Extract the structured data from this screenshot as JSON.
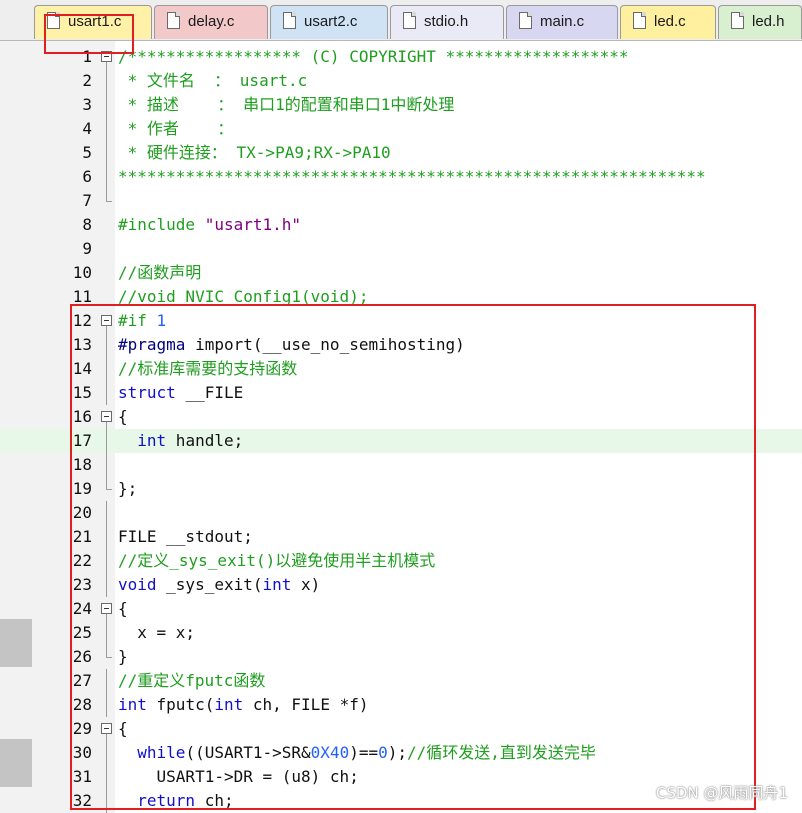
{
  "tabs": [
    {
      "label": "usart1.c",
      "active": true,
      "color": "#fff2a8",
      "icon": "c-file-icon"
    },
    {
      "label": "delay.c",
      "active": false,
      "color": "#f2c8c8",
      "icon": "c-file-icon"
    },
    {
      "label": "usart2.c",
      "active": false,
      "color": "#cfe3f5",
      "icon": "c-file-icon"
    },
    {
      "label": "stdio.h",
      "active": false,
      "color": "#eaeaf6",
      "icon": "h-file-icon"
    },
    {
      "label": "main.c",
      "active": false,
      "color": "#d7d7f2",
      "icon": "c-file-icon"
    },
    {
      "label": "led.c",
      "active": false,
      "color": "#fff0a0",
      "icon": "c-file-icon"
    },
    {
      "label": "led.h",
      "active": false,
      "color": "#d8efd0",
      "icon": "h-file-icon"
    }
  ],
  "editor": {
    "lines": [
      {
        "n": "1",
        "fold": "open",
        "tokens": [
          [
            "cm",
            "/****************** (C) COPYRIGHT *******************"
          ]
        ]
      },
      {
        "n": "2",
        "fold": "line",
        "tokens": [
          [
            "cm",
            " * 文件名  ： usart.c"
          ]
        ]
      },
      {
        "n": "3",
        "fold": "line",
        "tokens": [
          [
            "cm",
            " * 描述    ： 串口1的配置和串口1中断处理"
          ]
        ]
      },
      {
        "n": "4",
        "fold": "line",
        "tokens": [
          [
            "cm",
            " * 作者    ："
          ]
        ]
      },
      {
        "n": "5",
        "fold": "line",
        "tokens": [
          [
            "cm",
            " * 硬件连接： TX->PA9;RX->PA10"
          ]
        ]
      },
      {
        "n": "6",
        "fold": "line",
        "tokens": [
          [
            "cm",
            "*************************************************************"
          ]
        ]
      },
      {
        "n": "7",
        "fold": "end",
        "tokens": []
      },
      {
        "n": "8",
        "fold": "",
        "tokens": [
          [
            "pp",
            "#include "
          ],
          [
            "str",
            "\"usart1.h\""
          ]
        ]
      },
      {
        "n": "9",
        "fold": "",
        "tokens": []
      },
      {
        "n": "10",
        "fold": "",
        "tokens": [
          [
            "cm",
            "//函数声明"
          ]
        ]
      },
      {
        "n": "11",
        "fold": "",
        "tokens": [
          [
            "cm",
            "//void NVIC_Config1(void);"
          ]
        ]
      },
      {
        "n": "12",
        "fold": "open",
        "tokens": [
          [
            "pp",
            "#if "
          ],
          [
            "num",
            "1"
          ]
        ]
      },
      {
        "n": "13",
        "fold": "line",
        "tokens": [
          [
            "ppw",
            "#pragma"
          ],
          [
            "id",
            " import(__use_no_semihosting)"
          ]
        ]
      },
      {
        "n": "14",
        "fold": "line",
        "tokens": [
          [
            "cm",
            "//标准库需要的支持函数"
          ]
        ]
      },
      {
        "n": "15",
        "fold": "line",
        "tokens": [
          [
            "kw",
            "struct"
          ],
          [
            "id",
            " __FILE"
          ]
        ]
      },
      {
        "n": "16",
        "fold": "open",
        "tokens": [
          [
            "op",
            "{"
          ]
        ]
      },
      {
        "n": "17",
        "fold": "line",
        "hl": true,
        "tokens": [
          [
            "id",
            "  "
          ],
          [
            "kw",
            "int"
          ],
          [
            "id",
            " handle;"
          ]
        ]
      },
      {
        "n": "18",
        "fold": "line",
        "tokens": []
      },
      {
        "n": "19",
        "fold": "end",
        "tokens": [
          [
            "op",
            "};"
          ]
        ]
      },
      {
        "n": "20",
        "fold": "line",
        "tokens": []
      },
      {
        "n": "21",
        "fold": "line",
        "tokens": [
          [
            "id",
            "FILE __stdout;"
          ]
        ]
      },
      {
        "n": "22",
        "fold": "line",
        "tokens": [
          [
            "cm",
            "//定义_sys_exit()以避免使用半主机模式"
          ]
        ]
      },
      {
        "n": "23",
        "fold": "line",
        "tokens": [
          [
            "kw",
            "void"
          ],
          [
            "id",
            " _sys_exit("
          ],
          [
            "kw",
            "int"
          ],
          [
            "id",
            " x)"
          ]
        ]
      },
      {
        "n": "24",
        "fold": "open",
        "tokens": [
          [
            "op",
            "{"
          ]
        ]
      },
      {
        "n": "25",
        "fold": "line",
        "tokens": [
          [
            "id",
            "  x = x;"
          ]
        ]
      },
      {
        "n": "26",
        "fold": "end",
        "tokens": [
          [
            "op",
            "}"
          ]
        ]
      },
      {
        "n": "27",
        "fold": "line",
        "tokens": [
          [
            "cm",
            "//重定义fputc函数"
          ]
        ]
      },
      {
        "n": "28",
        "fold": "line",
        "tokens": [
          [
            "kw",
            "int"
          ],
          [
            "id",
            " fputc("
          ],
          [
            "kw",
            "int"
          ],
          [
            "id",
            " ch, FILE *f)"
          ]
        ]
      },
      {
        "n": "29",
        "fold": "open",
        "tokens": [
          [
            "op",
            "{"
          ]
        ]
      },
      {
        "n": "30",
        "fold": "line",
        "tokens": [
          [
            "id",
            "  "
          ],
          [
            "kw",
            "while"
          ],
          [
            "id",
            "((USART1->SR&"
          ],
          [
            "num",
            "0X40"
          ],
          [
            "id",
            ")=="
          ],
          [
            "num",
            "0"
          ],
          [
            "id",
            ");"
          ],
          [
            "cm",
            "//循环发送,直到发送完毕"
          ]
        ]
      },
      {
        "n": "31",
        "fold": "line",
        "tokens": [
          [
            "id",
            "    USART1->DR = (u8) ch;"
          ]
        ]
      },
      {
        "n": "32",
        "fold": "line",
        "tokens": [
          [
            "id",
            "  "
          ],
          [
            "kw",
            "return"
          ],
          [
            "id",
            " ch;"
          ]
        ]
      }
    ]
  },
  "watermark": "CSDN @风雨同舟1",
  "highlight_color": "#e02020"
}
